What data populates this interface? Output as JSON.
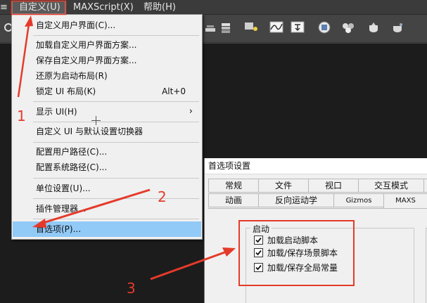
{
  "menubar": {
    "edge": "≡",
    "customize": "自定义(U)",
    "maxscript": "MAXScript(X)",
    "help": "帮助(H)"
  },
  "menu": {
    "items": [
      {
        "label": "自定义用户界面(C)..."
      },
      {
        "label": "加载自定义用户界面方案..."
      },
      {
        "label": "保存自定义用户界面方案..."
      },
      {
        "label": "还原为启动布局(R)"
      },
      {
        "label": "锁定 UI 布局(K)",
        "shortcut": "Alt+0"
      },
      {
        "label": "显示 UI(H)",
        "submenu": "›"
      },
      {
        "label": "自定义 UI 与默认设置切换器"
      },
      {
        "label": "配置用户路径(C)..."
      },
      {
        "label": "配置系统路径(C)..."
      },
      {
        "label": "单位设置(U)..."
      },
      {
        "label": "插件管理器..."
      },
      {
        "label": "首选项(P)..."
      }
    ]
  },
  "prefs": {
    "title": "首选项设置",
    "tabs_row1": [
      "常规",
      "文件",
      "视口",
      "交互模式"
    ],
    "tabs_row2": [
      "动画",
      "反向运动学",
      "Gizmos",
      "MAXS"
    ],
    "startup": {
      "legend": "启动",
      "options": [
        {
          "label": "加载启动脚本",
          "checked": true
        },
        {
          "label": "加载/保存场景脚本",
          "checked": true
        },
        {
          "label": "加载/保存全局常量",
          "checked": true
        }
      ]
    }
  },
  "annotations": {
    "steps": [
      "1",
      "2",
      "3"
    ],
    "color": "#e53a2a"
  },
  "colors": {
    "menu_bg": "#f0f0f0",
    "highlight": "#91c9f7",
    "app_bg": "#444444",
    "viewport_bg": "#1c1c1c"
  }
}
